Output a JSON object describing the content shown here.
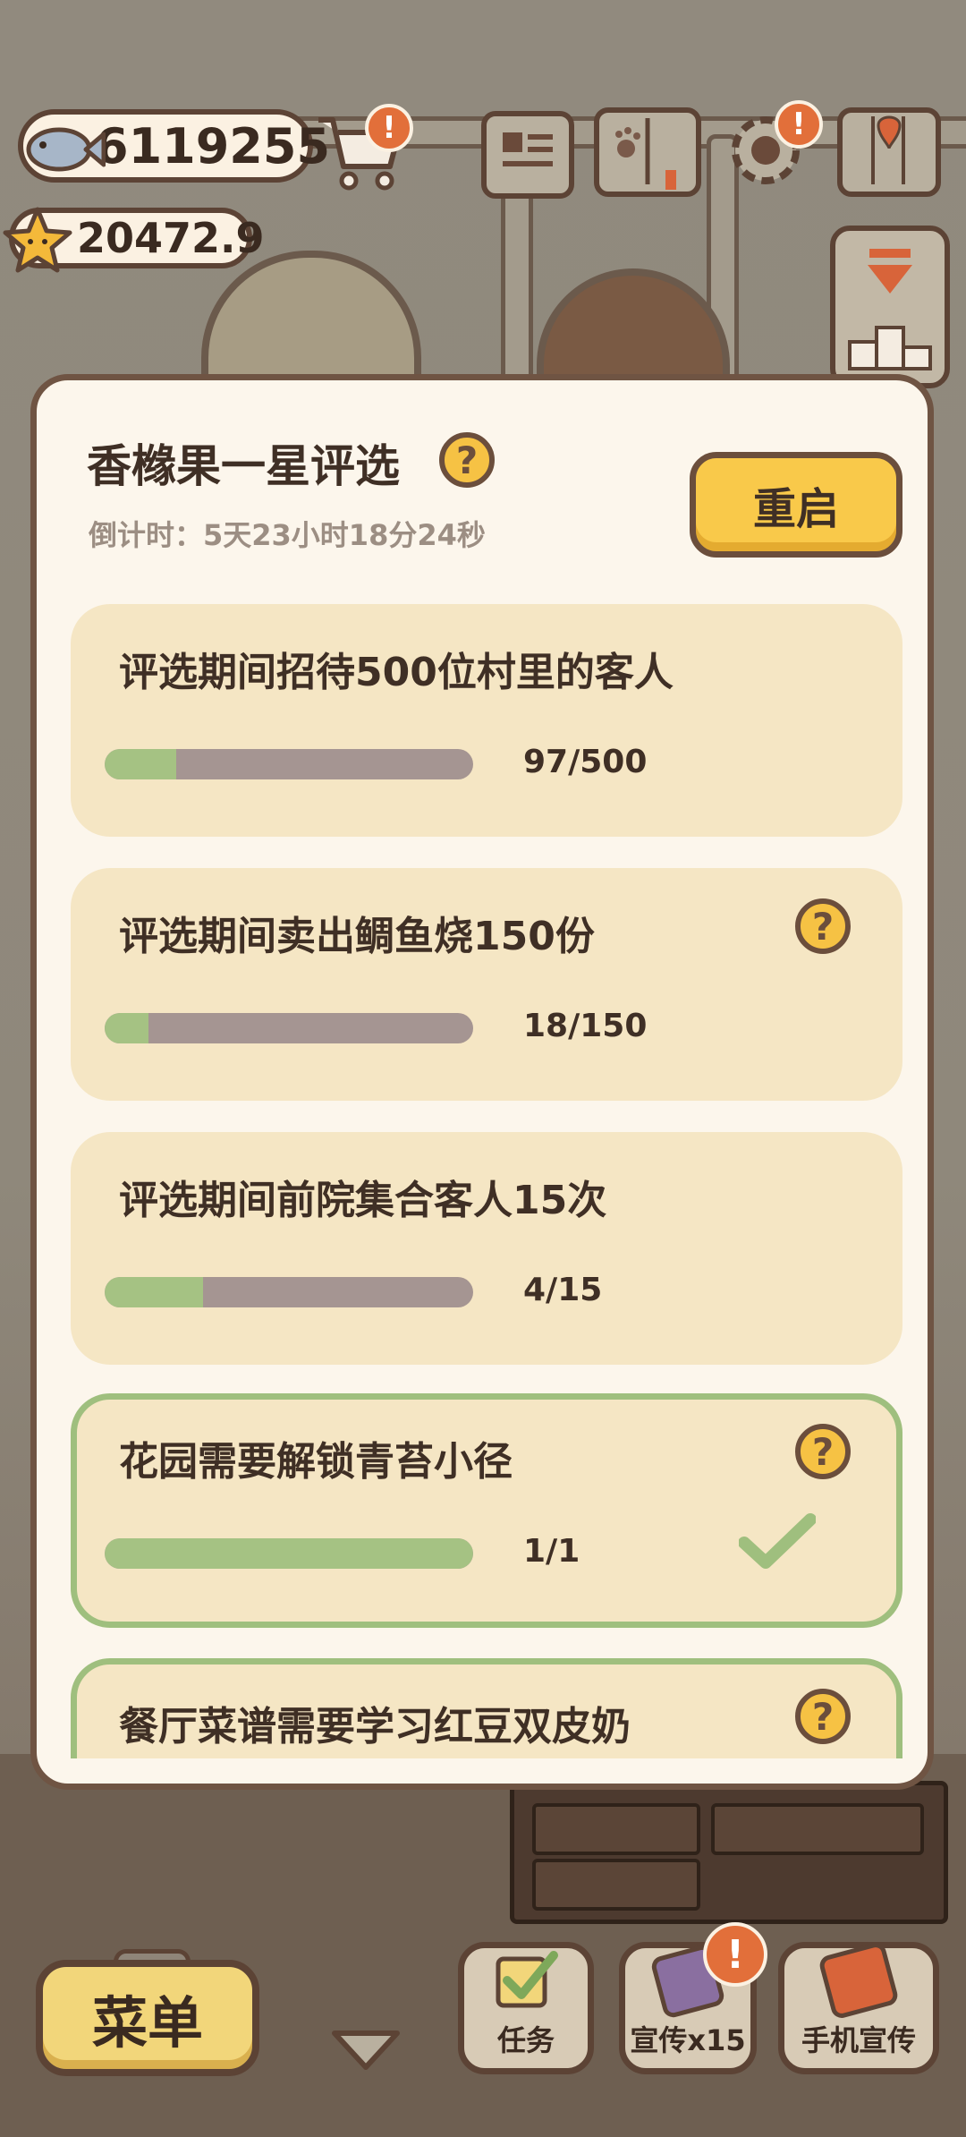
{
  "hud": {
    "fish_count": "6119255",
    "star_count": "20472.9",
    "cart_badge": "!",
    "settings_badge": "!"
  },
  "modal": {
    "title": "香橼果一星评选",
    "countdown": "倒计时：5天23小时18分24秒",
    "restart_label": "重启",
    "tasks": [
      {
        "title": "评选期间招待500位村里的客人",
        "progress_text": "97/500",
        "progress": 0.194,
        "has_help": false,
        "done": false
      },
      {
        "title": "评选期间卖出鲷鱼烧150份",
        "progress_text": "18/150",
        "progress": 0.12,
        "has_help": true,
        "done": false
      },
      {
        "title": "评选期间前院集合客人15次",
        "progress_text": "4/15",
        "progress": 0.267,
        "has_help": false,
        "done": false
      },
      {
        "title": "花园需要解锁青苔小径",
        "progress_text": "1/1",
        "progress": 1.0,
        "has_help": true,
        "done": true
      },
      {
        "title": "餐厅菜谱需要学习红豆双皮奶",
        "has_help": true,
        "done": true
      }
    ]
  },
  "bottom": {
    "menu_label": "菜单",
    "task_label": "任务",
    "promo_label": "宣传x15",
    "promo_badge": "!",
    "phone_promo_label": "手机宣传"
  },
  "colors": {
    "progress_fill": "#a5c283",
    "progress_track": "#a59592",
    "task_card": "#f5e6c4",
    "done_border": "#9fbf7e",
    "accent_yellow": "#f9c94a",
    "badge_orange": "#e26f3a"
  }
}
